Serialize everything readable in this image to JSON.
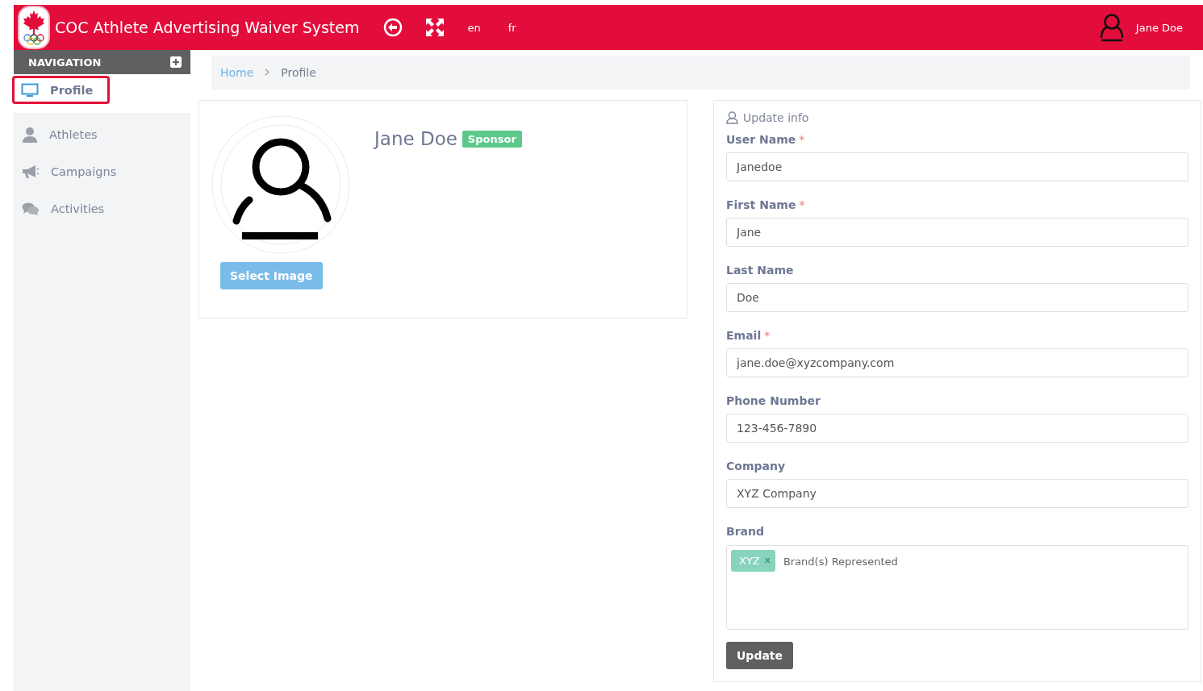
{
  "header": {
    "title": "COC Athlete Advertising Waiver System",
    "languages": [
      {
        "label": "en"
      },
      {
        "label": "fr"
      }
    ],
    "user": "Jane Doe"
  },
  "navigation": {
    "title": "NAVIGATION",
    "items": [
      {
        "label": "Profile",
        "selected": true
      },
      {
        "label": "Athletes",
        "selected": false
      },
      {
        "label": "Campaigns",
        "selected": false
      },
      {
        "label": "Activities",
        "selected": false
      }
    ]
  },
  "breadcrumb": [
    {
      "label": "Home",
      "kind": "link"
    },
    {
      "label": "Profile",
      "kind": "current"
    }
  ],
  "profile": {
    "name": "Jane Doe",
    "badge": "Sponsor",
    "button": "Select Image"
  },
  "form": {
    "title": "Update info",
    "fields": [
      {
        "label": "User Name",
        "required_mark": "*",
        "value": "Janedoe"
      },
      {
        "label": "First Name",
        "required_mark": "*",
        "value": "Jane"
      },
      {
        "label": "Last Name",
        "value": "Doe"
      },
      {
        "label": "Email",
        "required_mark": "*",
        "value": "jane.doe@xyzcompany.com"
      },
      {
        "label": "Phone Number",
        "value": "123-456-7890"
      },
      {
        "label": "Company",
        "value": "XYZ Company"
      }
    ],
    "brand": {
      "label": "Brand",
      "tags": [
        {
          "label": "XYZ",
          "remove": "x"
        }
      ],
      "placeholder": "Brand(s) Represented"
    },
    "submit": "Update"
  }
}
